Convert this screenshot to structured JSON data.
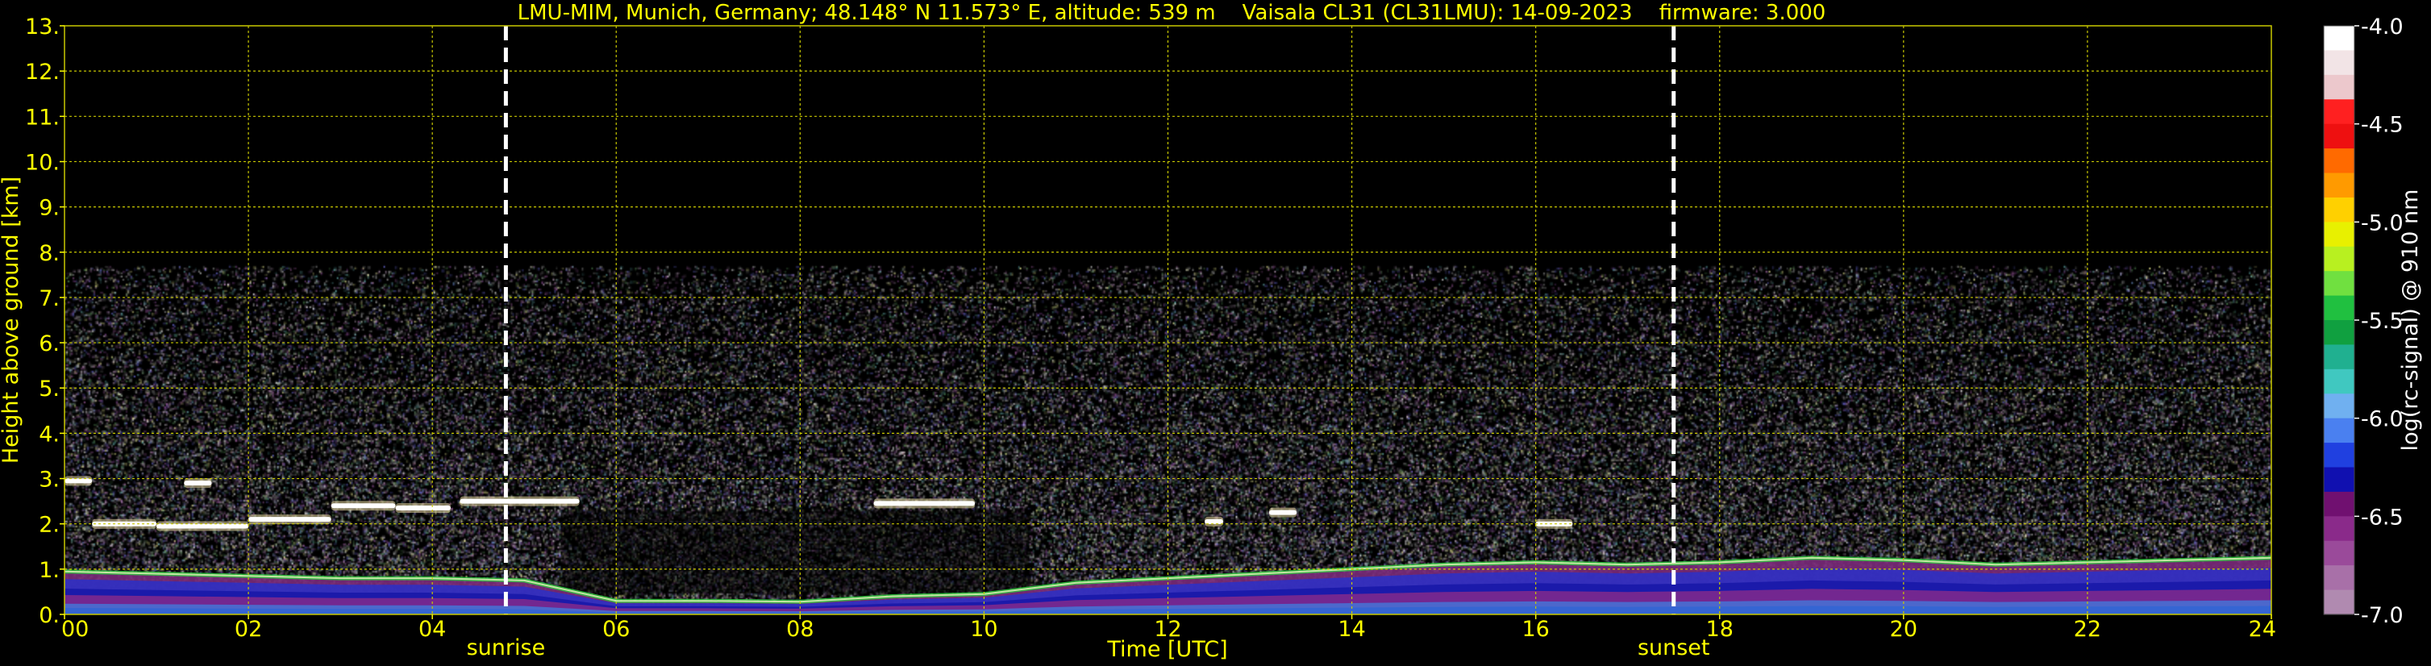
{
  "chart_data": {
    "type": "heatmap",
    "title": "LMU-MIM, Munich, Germany; 48.148° N 11.573° E, altitude: 539 m    Vaisala CL31 (CL31LMU): 14-09-2023    firmware: 3.000",
    "xlabel": "Time [UTC]",
    "ylabel": "Height above ground [km]",
    "xlim": [
      0,
      24
    ],
    "ylim": [
      0,
      13
    ],
    "x_ticks": [
      "00",
      "02",
      "04",
      "06",
      "08",
      "10",
      "12",
      "14",
      "16",
      "18",
      "20",
      "22",
      "24"
    ],
    "y_ticks": [
      "0.",
      "1.",
      "2.",
      "3.",
      "4.",
      "5.",
      "6.",
      "7.",
      "8.",
      "9.",
      "10.",
      "11.",
      "12.",
      "13."
    ],
    "grid": true,
    "markers": [
      {
        "label": "sunrise",
        "x": 4.8
      },
      {
        "label": "sunset",
        "x": 17.5
      }
    ],
    "signal_top_km": 7.7,
    "cloud_layers": [
      {
        "x_start": 0.0,
        "x_end": 0.3,
        "y": 2.95
      },
      {
        "x_start": 1.3,
        "x_end": 1.6,
        "y": 2.9
      },
      {
        "x_start": 0.3,
        "x_end": 1.0,
        "y": 2.0
      },
      {
        "x_start": 1.0,
        "x_end": 2.0,
        "y": 1.95
      },
      {
        "x_start": 2.0,
        "x_end": 2.9,
        "y": 2.1
      },
      {
        "x_start": 2.9,
        "x_end": 3.6,
        "y": 2.4
      },
      {
        "x_start": 3.6,
        "x_end": 4.2,
        "y": 2.35
      },
      {
        "x_start": 4.3,
        "x_end": 5.6,
        "y": 2.5
      },
      {
        "x_start": 8.8,
        "x_end": 9.9,
        "y": 2.45
      },
      {
        "x_start": 12.4,
        "x_end": 12.6,
        "y": 2.05
      },
      {
        "x_start": 13.1,
        "x_end": 13.4,
        "y": 2.25
      },
      {
        "x_start": 16.0,
        "x_end": 16.4,
        "y": 2.0
      }
    ],
    "boundary_layer": [
      {
        "x": 0,
        "y": 0.95
      },
      {
        "x": 1,
        "y": 0.9
      },
      {
        "x": 2,
        "y": 0.85
      },
      {
        "x": 3,
        "y": 0.8
      },
      {
        "x": 4,
        "y": 0.8
      },
      {
        "x": 5,
        "y": 0.75
      },
      {
        "x": 6,
        "y": 0.3
      },
      {
        "x": 7,
        "y": 0.3
      },
      {
        "x": 8,
        "y": 0.28
      },
      {
        "x": 9,
        "y": 0.4
      },
      {
        "x": 10,
        "y": 0.45
      },
      {
        "x": 11,
        "y": 0.7
      },
      {
        "x": 12,
        "y": 0.8
      },
      {
        "x": 13,
        "y": 0.9
      },
      {
        "x": 14,
        "y": 1.0
      },
      {
        "x": 15,
        "y": 1.1
      },
      {
        "x": 16,
        "y": 1.15
      },
      {
        "x": 17,
        "y": 1.1
      },
      {
        "x": 18,
        "y": 1.15
      },
      {
        "x": 19,
        "y": 1.25
      },
      {
        "x": 20,
        "y": 1.2
      },
      {
        "x": 21,
        "y": 1.1
      },
      {
        "x": 22,
        "y": 1.15
      },
      {
        "x": 23,
        "y": 1.2
      },
      {
        "x": 24,
        "y": 1.25
      }
    ],
    "colorbar": {
      "label": "log(rc-signal) @ 910 nm",
      "min": -7.0,
      "max": -4.0,
      "tick_labels": [
        "-4.0",
        "-4.5",
        "-5.0",
        "-5.5",
        "-6.0",
        "-6.5",
        "-7.0"
      ],
      "colors": [
        "#ffffff",
        "#f2e4e6",
        "#ecc8cc",
        "#ff2020",
        "#ee1010",
        "#ff6a00",
        "#ff9a00",
        "#ffd000",
        "#e8f000",
        "#b8f020",
        "#70e040",
        "#20c040",
        "#10a040",
        "#20b090",
        "#40c8c0",
        "#70b0f0",
        "#4a80f0",
        "#2040e0",
        "#1010b0",
        "#701070",
        "#8a2a8a",
        "#9a4a9a",
        "#a870a8",
        "#b08ab0"
      ]
    },
    "colors": {
      "text": "#ffff00",
      "grid": "#c8c800",
      "marker": "#ffffff",
      "background": "#000000"
    }
  }
}
